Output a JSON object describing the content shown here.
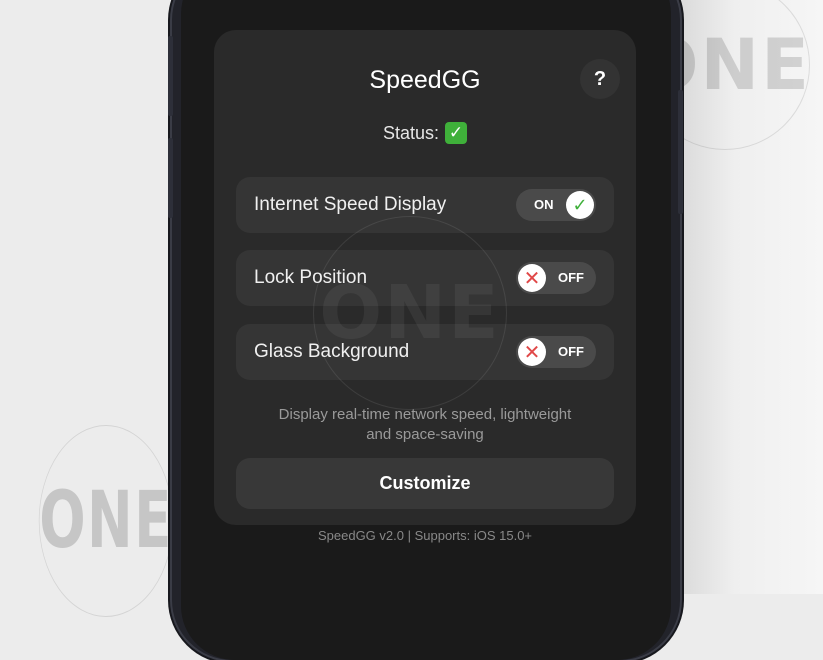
{
  "watermark": {
    "text": "ONE"
  },
  "app": {
    "title": "SpeedGG",
    "help_label": "?",
    "status_label": "Status:",
    "status_icon": "✓",
    "status_color": "#3fb03a"
  },
  "settings": [
    {
      "label": "Internet Speed Display",
      "state": "ON",
      "icon": "✓"
    },
    {
      "label": "Lock Position",
      "state": "OFF",
      "icon": "✕"
    },
    {
      "label": "Glass Background",
      "state": "OFF",
      "icon": "✕"
    }
  ],
  "description": {
    "line1": "Display real-time network speed, lightweight",
    "line2": "and space-saving"
  },
  "customize_label": "Customize",
  "footer": "SpeedGG v2.0 | Supports: iOS 15.0+",
  "colors": {
    "on_check": "#3fb03a",
    "off_cross": "#e04848",
    "panel": "#2a2a2a",
    "screen": "#1a1a1a"
  }
}
